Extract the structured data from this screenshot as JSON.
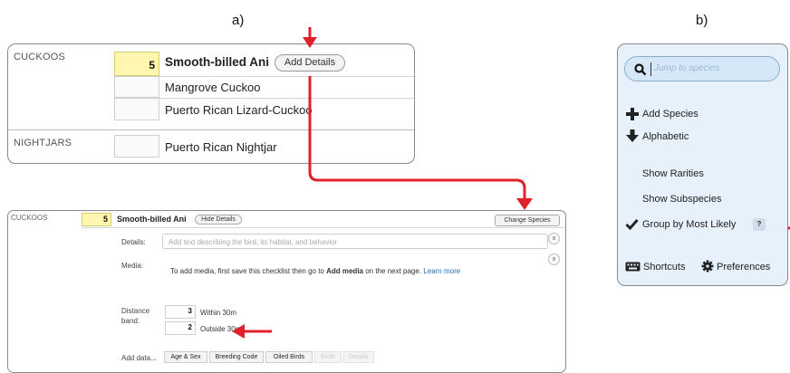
{
  "labels": {
    "a": "a)",
    "b": "b)"
  },
  "top_card": {
    "rows": [
      {
        "category": "CUCKOOS",
        "count": "5",
        "species": "Smooth-billed Ani",
        "action": "Add Details"
      },
      {
        "category": "",
        "count": "",
        "species": "Mangrove Cuckoo"
      },
      {
        "category": "",
        "count": "",
        "species": "Puerto Rican Lizard-Cuckoo"
      },
      {
        "category": "NIGHTJARS",
        "count": "",
        "species": "Puerto Rican Nightjar"
      }
    ]
  },
  "detail_card": {
    "category": "CUCKOOS",
    "count": "5",
    "species": "Smooth-billed Ani",
    "hide_details": "Hide Details",
    "change_species": "Change Species",
    "details_label": "Details:",
    "details_placeholder": "Add text describing the bird, its habitat, and behavior",
    "media_label": "Media:",
    "media_text_pre": "To add media, first save this checklist then go to ",
    "media_text_bold": "Add media",
    "media_text_post": " on the next page.",
    "learn_more": "Learn more",
    "close": "x",
    "distance_label_1": "Distance",
    "distance_label_2": "band:",
    "bands": [
      {
        "count": "3",
        "label": "Within 30m"
      },
      {
        "count": "2",
        "label": "Outside 30m"
      }
    ],
    "add_data_label": "Add data...",
    "tabs": [
      "Age & Sex",
      "Breeding Code",
      "Oiled Birds",
      "Birds",
      "Details"
    ]
  },
  "sidebar": {
    "search_placeholder": "Jump to species",
    "add_species": "Add Species",
    "alphabetic": "Alphabetic",
    "show_rarities": "Show Rarities",
    "show_subspecies": "Show Subspecies",
    "group_by": "Group by Most Likely",
    "help": "?",
    "shortcuts": "Shortcuts",
    "preferences": "Preferences"
  },
  "colors": {
    "arrow": "#e0202a",
    "highlight": "#fff6b0",
    "sidebar_bg": "#e6f1fb"
  }
}
